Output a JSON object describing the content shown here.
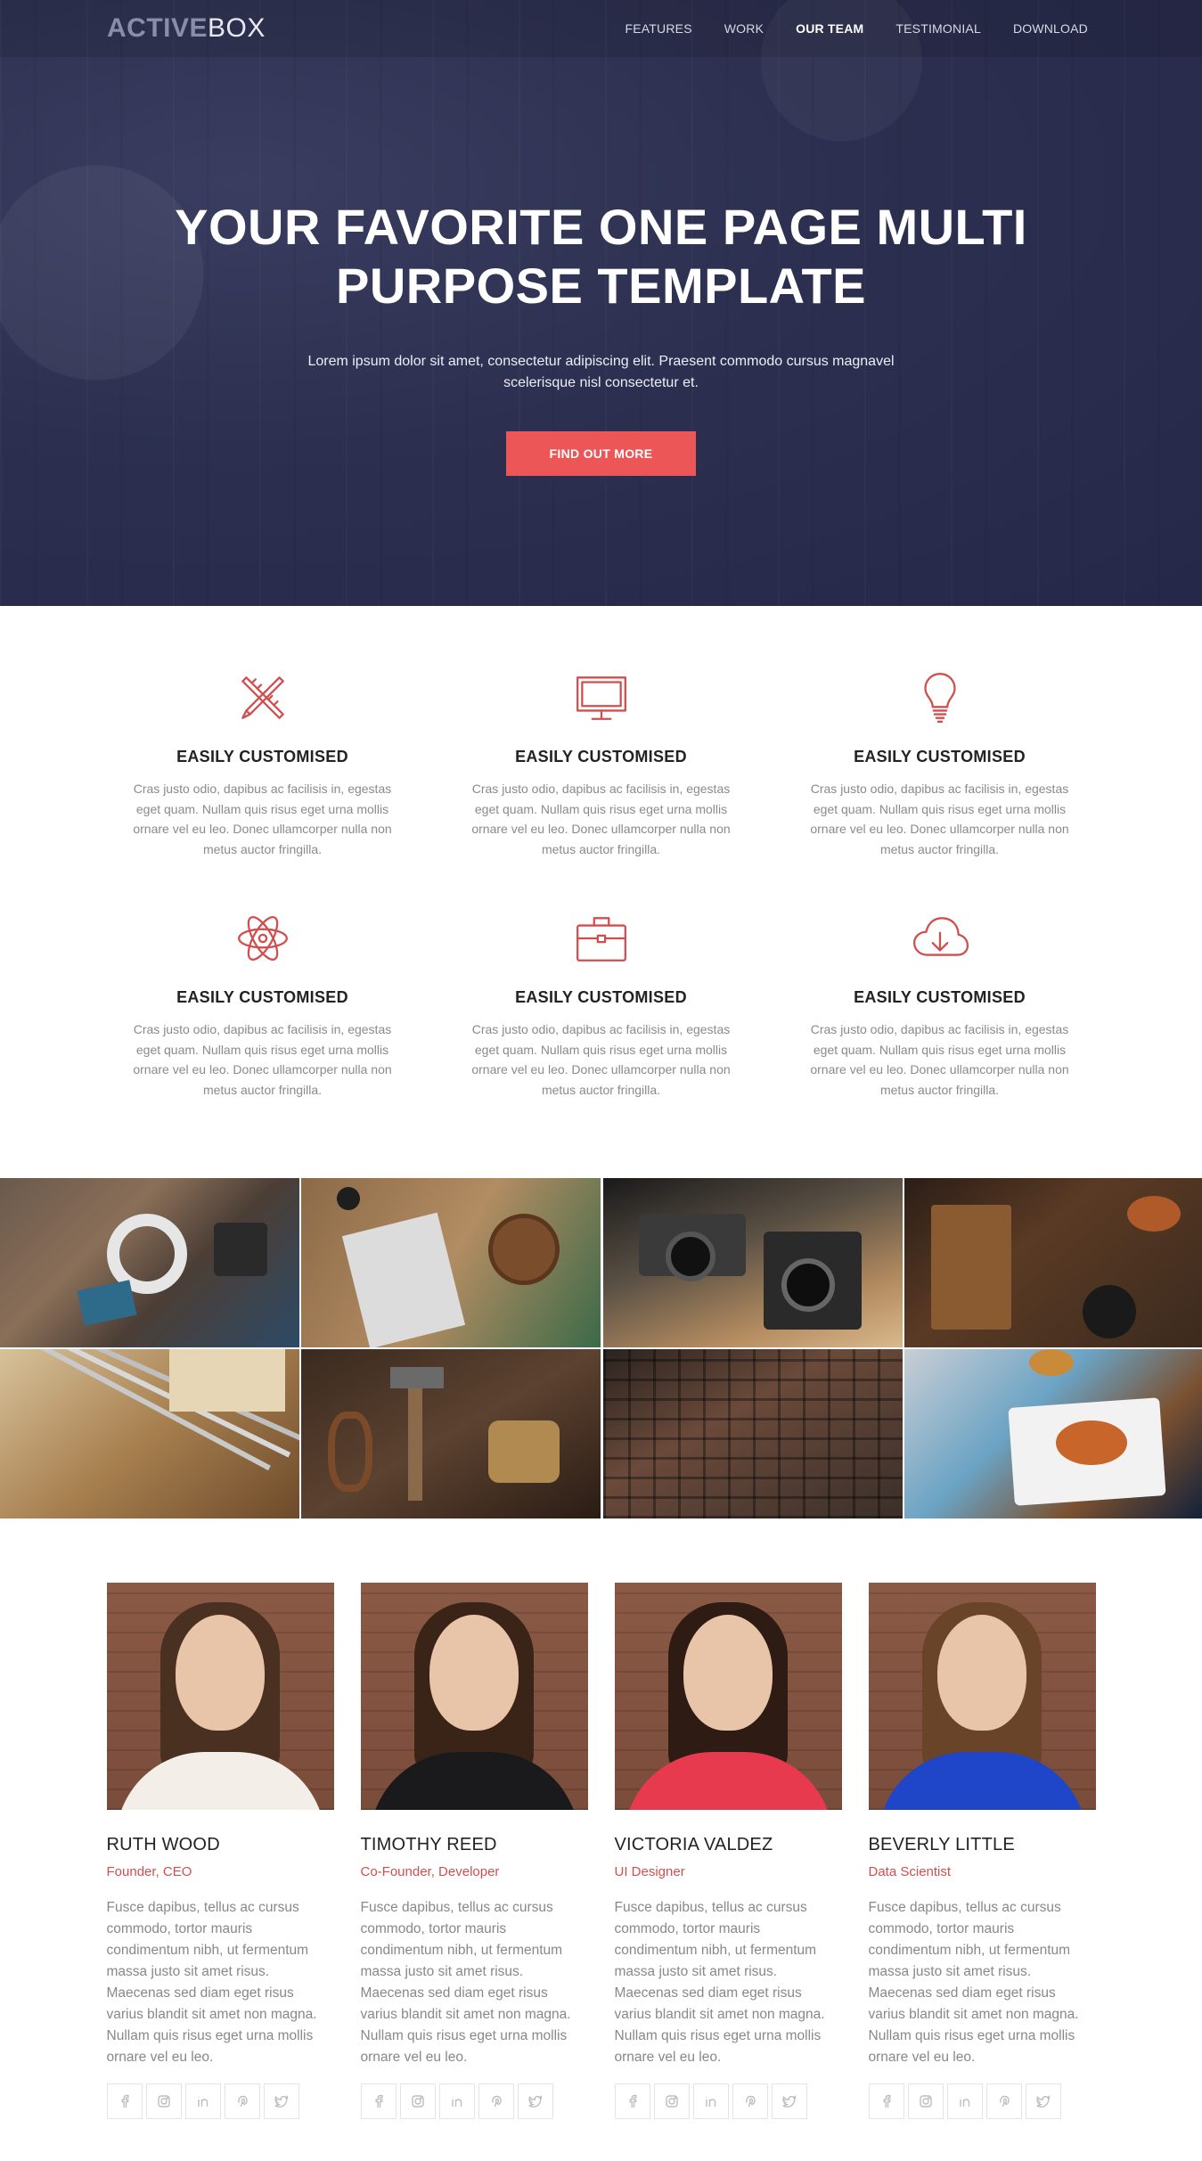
{
  "brand": {
    "logo_bold": "ACTIVE",
    "logo_light": "BOX"
  },
  "nav": {
    "items": [
      {
        "label": "FEATURES"
      },
      {
        "label": "WORK"
      },
      {
        "label": "OUR TEAM",
        "active": true
      },
      {
        "label": "TESTIMONIAL"
      },
      {
        "label": "DOWNLOAD"
      }
    ]
  },
  "hero": {
    "title": "YOUR FAVORITE ONE PAGE MULTI PURPOSE TEMPLATE",
    "subtitle": "Lorem ipsum dolor sit amet, consectetur adipiscing elit. Praesent commodo cursus magnavel scelerisque nisl consectetur et.",
    "cta_label": "FIND OUT MORE"
  },
  "features": [
    {
      "icon": "pencil-ruler-icon",
      "title": "EASILY CUSTOMISED",
      "text": "Cras justo odio, dapibus ac facilisis in, egestas eget quam. Nullam quis risus eget urna mollis ornare vel eu leo. Donec ullamcorper nulla non metus auctor fringilla."
    },
    {
      "icon": "monitor-icon",
      "title": "EASILY CUSTOMISED",
      "text": "Cras justo odio, dapibus ac facilisis in, egestas eget quam. Nullam quis risus eget urna mollis ornare vel eu leo. Donec ullamcorper nulla non metus auctor fringilla."
    },
    {
      "icon": "lightbulb-icon",
      "title": "EASILY CUSTOMISED",
      "text": "Cras justo odio, dapibus ac facilisis in, egestas eget quam. Nullam quis risus eget urna mollis ornare vel eu leo. Donec ullamcorper nulla non metus auctor fringilla."
    },
    {
      "icon": "atom-icon",
      "title": "EASILY CUSTOMISED",
      "text": "Cras justo odio, dapibus ac facilisis in, egestas eget quam. Nullam quis risus eget urna mollis ornare vel eu leo. Donec ullamcorper nulla non metus auctor fringilla."
    },
    {
      "icon": "briefcase-icon",
      "title": "EASILY CUSTOMISED",
      "text": "Cras justo odio, dapibus ac facilisis in, egestas eget quam. Nullam quis risus eget urna mollis ornare vel eu leo. Donec ullamcorper nulla non metus auctor fringilla."
    },
    {
      "icon": "cloud-download-icon",
      "title": "EASILY CUSTOMISED",
      "text": "Cras justo odio, dapibus ac facilisis in, egestas eget quam. Nullam quis risus eget urna mollis ornare vel eu leo. Donec ullamcorper nulla non metus auctor fringilla."
    }
  ],
  "gallery": [
    {
      "name": "stationery-flatlay"
    },
    {
      "name": "notebook-coasters"
    },
    {
      "name": "vintage-cameras"
    },
    {
      "name": "cutting-board-spices"
    },
    {
      "name": "pencils-desk"
    },
    {
      "name": "hand-tools"
    },
    {
      "name": "letterpress-type"
    },
    {
      "name": "food-plate"
    }
  ],
  "team": [
    {
      "name": "RUTH WOOD",
      "role": "Founder, CEO",
      "bio": "Fusce dapibus, tellus ac cursus commodo, tortor mauris condimentum nibh, ut fermentum massa justo sit amet risus. Maecenas sed diam eget risus varius blandit sit amet non magna. Nullam quis risus eget urna mollis ornare vel eu leo.",
      "hair": "#4a3020",
      "shirt": "#f3efe8"
    },
    {
      "name": "TIMOTHY REED",
      "role": "Co-Founder, Developer",
      "bio": "Fusce dapibus, tellus ac cursus commodo, tortor mauris condimentum nibh, ut fermentum massa justo sit amet risus. Maecenas sed diam eget risus varius blandit sit amet non magna. Nullam quis risus eget urna mollis ornare vel eu leo.",
      "hair": "#3a2418",
      "shirt": "#1a1a1c"
    },
    {
      "name": "VICTORIA VALDEZ",
      "role": "UI Designer",
      "bio": "Fusce dapibus, tellus ac cursus commodo, tortor mauris condimentum nibh, ut fermentum massa justo sit amet risus. Maecenas sed diam eget risus varius blandit sit amet non magna. Nullam quis risus eget urna mollis ornare vel eu leo.",
      "hair": "#2e1c14",
      "shirt": "#e83a4e"
    },
    {
      "name": "BEVERLY LITTLE",
      "role": "Data Scientist",
      "bio": "Fusce dapibus, tellus ac cursus commodo, tortor mauris condimentum nibh, ut fermentum massa justo sit amet risus. Maecenas sed diam eget risus varius blandit sit amet non magna. Nullam quis risus eget urna mollis ornare vel eu leo.",
      "hair": "#6a4428",
      "shirt": "#1f46c8"
    }
  ],
  "social_icons": [
    "facebook-icon",
    "instagram-icon",
    "linkedin-icon",
    "pinterest-icon",
    "twitter-icon"
  ],
  "colors": {
    "accent": "#ec5657",
    "hero_bg": "#2c2f4f",
    "icon_red": "#d24e4e"
  }
}
